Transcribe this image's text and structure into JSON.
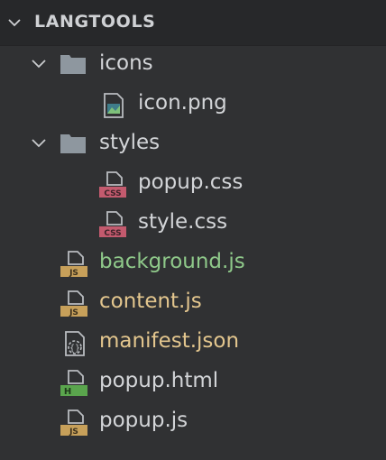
{
  "explorer": {
    "section_title": "LANGTOOLS",
    "items": [
      {
        "label": "icons",
        "kind": "folder"
      },
      {
        "label": "icon.png",
        "kind": "image"
      },
      {
        "label": "styles",
        "kind": "folder"
      },
      {
        "label": "popup.css",
        "kind": "css",
        "badge": "CSS"
      },
      {
        "label": "style.css",
        "kind": "css",
        "badge": "CSS"
      },
      {
        "label": "background.js",
        "kind": "js",
        "badge": "JS"
      },
      {
        "label": "content.js",
        "kind": "js",
        "badge": "JS"
      },
      {
        "label": "manifest.json",
        "kind": "json"
      },
      {
        "label": "popup.html",
        "kind": "html",
        "badge": "H"
      },
      {
        "label": "popup.js",
        "kind": "js",
        "badge": "JS"
      }
    ]
  },
  "colors": {
    "background": "#303133",
    "header": "#27282a",
    "text": "#d3d5d8",
    "js_badge": "#c7a05a",
    "css_badge": "#c35a6e",
    "html_badge": "#5aa54d",
    "git_added": "#8fc98a",
    "git_modified": "#e3c68e"
  }
}
